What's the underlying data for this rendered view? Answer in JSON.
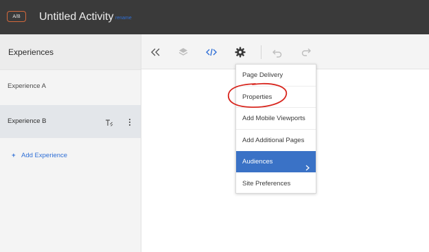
{
  "topbar": {
    "badge": "A/B",
    "title": "Untitled Activity",
    "rename": "rename"
  },
  "sidebar": {
    "title": "Experiences",
    "experiences": [
      {
        "label": "Experience A"
      },
      {
        "label": "Experience B"
      }
    ],
    "add_label": "Add Experience",
    "add_plus": "+"
  },
  "toolbar": {
    "icons": [
      "collapse-icon",
      "layers-icon",
      "code-icon",
      "gear-icon",
      "undo-icon",
      "redo-icon"
    ]
  },
  "menu": {
    "items": [
      {
        "label": "Page Delivery"
      },
      {
        "label": "Properties"
      },
      {
        "label": "Add Mobile Viewports"
      },
      {
        "label": "Add Additional Pages"
      },
      {
        "label": "Audiences"
      },
      {
        "label": "Site Preferences"
      }
    ]
  },
  "colors": {
    "topbar_bg": "#3a3a3a",
    "accent_blue": "#3a72c6",
    "link_blue": "#2f6fd6",
    "badge_orange": "#d5693c",
    "annotation_red": "#d8261e"
  }
}
